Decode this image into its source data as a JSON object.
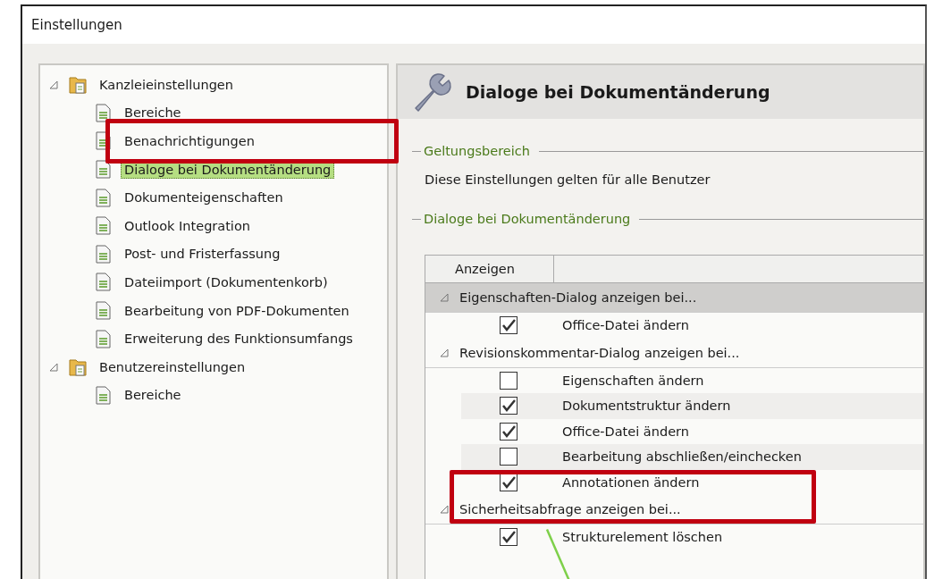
{
  "window": {
    "title": "Einstellungen"
  },
  "tree": [
    {
      "label": "Kanzleieinstellungen",
      "expanded": true,
      "children": [
        {
          "label": "Bereiche",
          "selected": false
        },
        {
          "label": "Benachrichtigungen",
          "selected": false
        },
        {
          "label": "Dialoge bei Dokumentänderung",
          "selected": true
        },
        {
          "label": "Dokumenteigenschaften",
          "selected": false
        },
        {
          "label": "Outlook Integration",
          "selected": false
        },
        {
          "label": "Post- und Fristerfassung",
          "selected": false
        },
        {
          "label": "Dateiimport (Dokumentenkorb)",
          "selected": false
        },
        {
          "label": "Bearbeitung von PDF-Dokumenten",
          "selected": false
        },
        {
          "label": "Erweiterung des Funktionsumfangs",
          "selected": false
        }
      ]
    },
    {
      "label": "Benutzereinstellungen",
      "expanded": true,
      "children": [
        {
          "label": "Bereiche",
          "selected": false
        }
      ]
    }
  ],
  "panel": {
    "title": "Dialoge bei Dokumentänderung",
    "scope": {
      "legend": "Geltungsbereich",
      "text": "Diese Einstellungen gelten für alle Benutzer"
    },
    "dialogs": {
      "legend": "Dialoge bei Dokumentänderung",
      "columns": [
        "Anzeigen"
      ],
      "groups": [
        {
          "label": "Eigenschaften-Dialog anzeigen bei...",
          "expanded": true,
          "selected": true,
          "items": [
            {
              "label": "Office-Datei ändern",
              "checked": true
            }
          ]
        },
        {
          "label": "Revisionskommentar-Dialog anzeigen bei...",
          "expanded": true,
          "selected": false,
          "items": [
            {
              "label": "Eigenschaften ändern",
              "checked": false
            },
            {
              "label": "Dokumentstruktur ändern",
              "checked": true
            },
            {
              "label": "Office-Datei ändern",
              "checked": true
            },
            {
              "label": "Bearbeitung abschließen/einchecken",
              "checked": false
            },
            {
              "label": "Annotationen ändern",
              "checked": true
            }
          ]
        },
        {
          "label": "Sicherheitsabfrage anzeigen bei...",
          "expanded": true,
          "selected": false,
          "items": [
            {
              "label": "Strukturelement löschen",
              "checked": true
            }
          ]
        }
      ]
    }
  },
  "annotations": [
    {
      "kind": "frame"
    },
    {
      "kind": "frame"
    },
    {
      "kind": "line"
    }
  ]
}
